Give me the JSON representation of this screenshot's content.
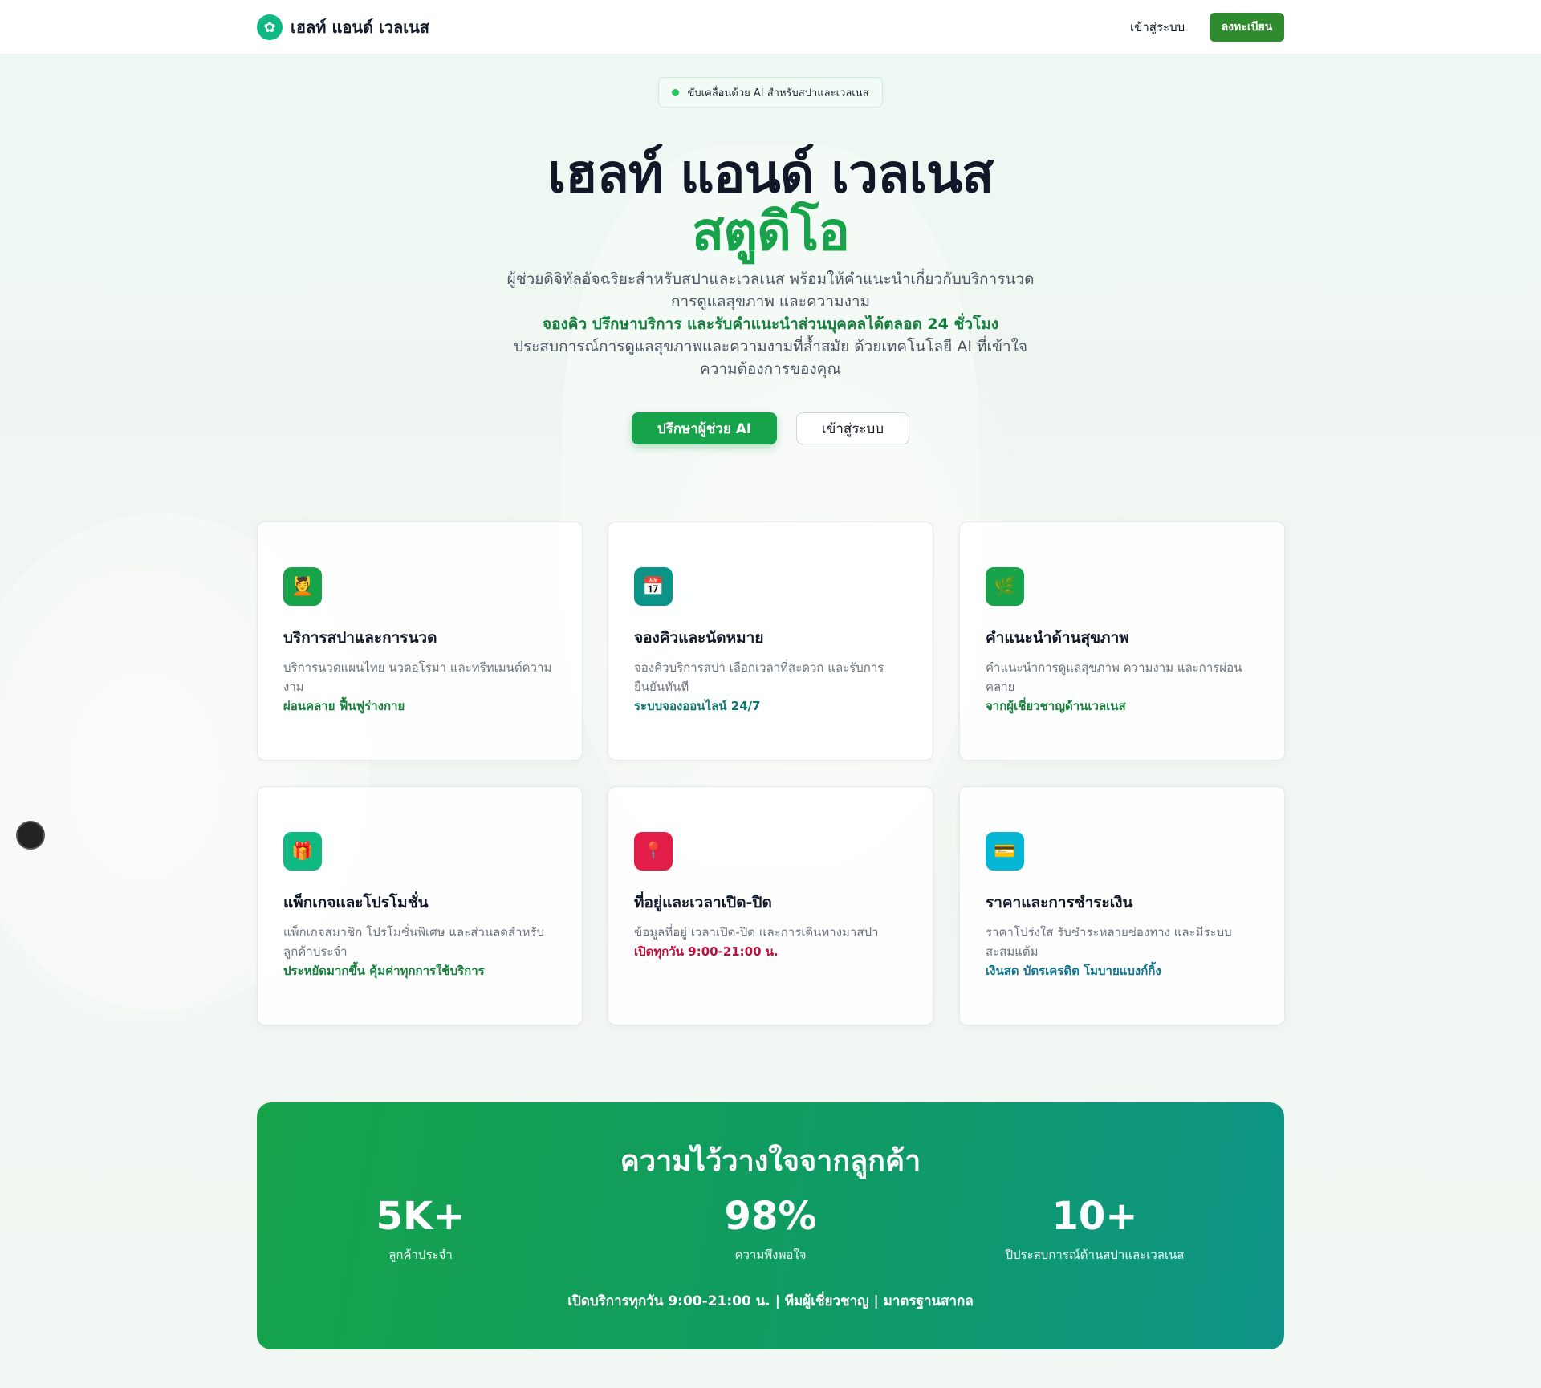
{
  "nav": {
    "brand": "เฮลท์ แอนด์ เวลเนส",
    "login": "เข้าสู่ระบบ",
    "register": "ลงทะเบียน"
  },
  "hero": {
    "badge": "ขับเคลื่อนด้วย AI สำหรับสปาและเวลเนส",
    "title_line1": "เฮลท์ แอนด์ เวลเนส",
    "title_line2": "สตูดิโอ",
    "desc1": "ผู้ช่วยดิจิทัลอัจฉริยะสำหรับสปาและเวลเนส พร้อมให้คำแนะนำเกี่ยวกับบริการนวด การดูแลสุขภาพ และความงาม",
    "desc_highlight": "จองคิว ปรึกษาบริการ และรับคำแนะนำส่วนบุคคลได้ตลอด 24 ชั่วโมง",
    "desc2": "ประสบการณ์การดูแลสุขภาพและความงามที่ล้ำสมัย ด้วยเทคโนโลยี AI ที่เข้าใจความต้องการของคุณ",
    "primary_button": "ปรึกษาผู้ช่วย AI",
    "secondary_button": "เข้าสู่ระบบ"
  },
  "cards": [
    {
      "icon": "massage-icon",
      "glyph": "💆",
      "color": "#16a34a",
      "title": "บริการสปาและการนวด",
      "desc": "บริการนวดแผนไทย นวดอโรมา และทรีทเมนต์ความงาม",
      "highlight": "ผ่อนคลาย ฟื้นฟูร่างกาย",
      "highlight_color": "#15803d"
    },
    {
      "icon": "calendar-icon",
      "glyph": "📅",
      "color": "#0d9488",
      "title": "จองคิวและนัดหมาย",
      "desc": "จองคิวบริการสปา เลือกเวลาที่สะดวก และรับการยืนยันทันที",
      "highlight": "ระบบจองออนไลน์ 24/7",
      "highlight_color": "#0f766e"
    },
    {
      "icon": "herb-icon",
      "glyph": "🌿",
      "color": "#16a34a",
      "title": "คำแนะนำด้านสุขภาพ",
      "desc": "คำแนะนำการดูแลสุขภาพ ความงาม และการผ่อนคลาย",
      "highlight": "จากผู้เชี่ยวชาญด้านเวลเนส",
      "highlight_color": "#15803d"
    },
    {
      "icon": "gift-icon",
      "glyph": "🎁",
      "color": "#10b981",
      "title": "แพ็กเกจและโปรโมชั่น",
      "desc": "แพ็กเกจสมาชิก โปรโมชั่นพิเศษ และส่วนลดสำหรับลูกค้าประจำ",
      "highlight": "ประหยัดมากขึ้น คุ้มค่าทุกการใช้บริการ",
      "highlight_color": "#15803d"
    },
    {
      "icon": "location-pin-icon",
      "glyph": "📍",
      "color": "#e11d48",
      "title": "ที่อยู่และเวลาเปิด-ปิด",
      "desc": "ข้อมูลที่อยู่ เวลาเปิด-ปิด และการเดินทางมาสปา",
      "highlight": "เปิดทุกวัน 9:00-21:00 น.",
      "highlight_color": "#be123c"
    },
    {
      "icon": "credit-card-icon",
      "glyph": "💳",
      "color": "#06b6d4",
      "title": "ราคาและการชำระเงิน",
      "desc": "ราคาโปร่งใส รับชำระหลายช่องทาง และมีระบบสะสมแต้ม",
      "highlight": "เงินสด บัตรเครดิต โมบายแบงก์กิ้ง",
      "highlight_color": "#0e7490"
    }
  ],
  "stats": {
    "title": "ความไว้วางใจจากลูกค้า",
    "items": [
      {
        "value": "5K+",
        "label": "ลูกค้าประจำ"
      },
      {
        "value": "98%",
        "label": "ความพึงพอใจ"
      },
      {
        "value": "10+",
        "label": "ปีประสบการณ์ด้านสปาและเวลเนส"
      }
    ],
    "footer": "เปิดบริการทุกวัน 9:00-21:00 น. | ทีมผู้เชี่ยวชาญ | มาตรฐานสากล"
  }
}
